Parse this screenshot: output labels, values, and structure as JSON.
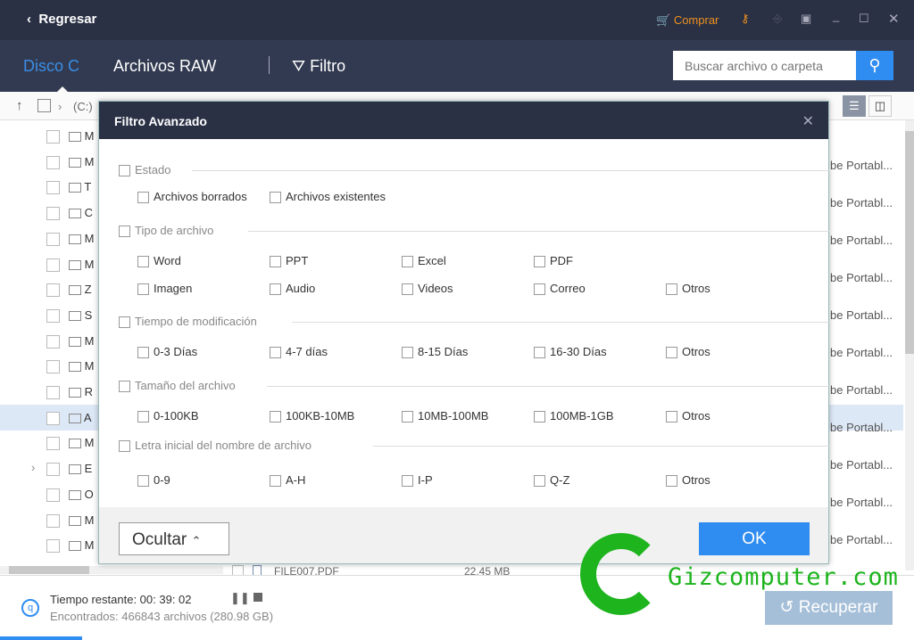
{
  "titlebar": {
    "back": "Regresar",
    "buy": "Comprar"
  },
  "nav": {
    "tabs": [
      "Disco C",
      "Archivos RAW"
    ],
    "filter": "Filtro",
    "search_placeholder": "Buscar archivo o carpeta"
  },
  "toolbar": {
    "path": "(C:)"
  },
  "list": {
    "initials": [
      "M",
      "M",
      "T",
      "C",
      "M",
      "M",
      "Z",
      "S",
      "M",
      "M",
      "R",
      "A",
      "M",
      "E",
      "O",
      "M",
      "M"
    ],
    "type_col": "be Portabl...",
    "partial_row": {
      "name": "FILE007.PDF",
      "size": "22.45 MB"
    }
  },
  "dialog": {
    "title": "Filtro Avanzado",
    "sections": [
      {
        "label": "Estado",
        "options": [
          "Archivos borrados",
          "Archivos existentes"
        ]
      },
      {
        "label": "Tipo de archivo",
        "options": [
          "Word",
          "PPT",
          "Excel",
          "PDF",
          "Imagen",
          "Audio",
          "Videos",
          "Correo",
          "Otros"
        ]
      },
      {
        "label": "Tiempo de modificación",
        "options": [
          "0-3 Días",
          "4-7 días",
          "8-15 Días",
          "16-30 Días",
          "Otros"
        ]
      },
      {
        "label": "Tamaño del archivo",
        "options": [
          "0-100KB",
          "100KB-10MB",
          "10MB-100MB",
          "100MB-1GB",
          "Otros"
        ]
      },
      {
        "label": "Letra inicial del nombre de archivo",
        "options": [
          "0-9",
          "A-H",
          "I-P",
          "Q-Z",
          "Otros"
        ]
      }
    ],
    "hide": "Ocultar",
    "ok": "OK"
  },
  "status": {
    "remaining": "Tiempo restante: 00: 39: 02",
    "found": "Encontrados: 466843 archivos (280.98 GB)",
    "recover": "Recuperar"
  },
  "watermark": {
    "text": "Gizcomputer.com"
  },
  "colors": {
    "accent": "#2f8cf0",
    "orange": "#f0901e",
    "dark": "#2a3145",
    "green": "#1eb41e"
  }
}
